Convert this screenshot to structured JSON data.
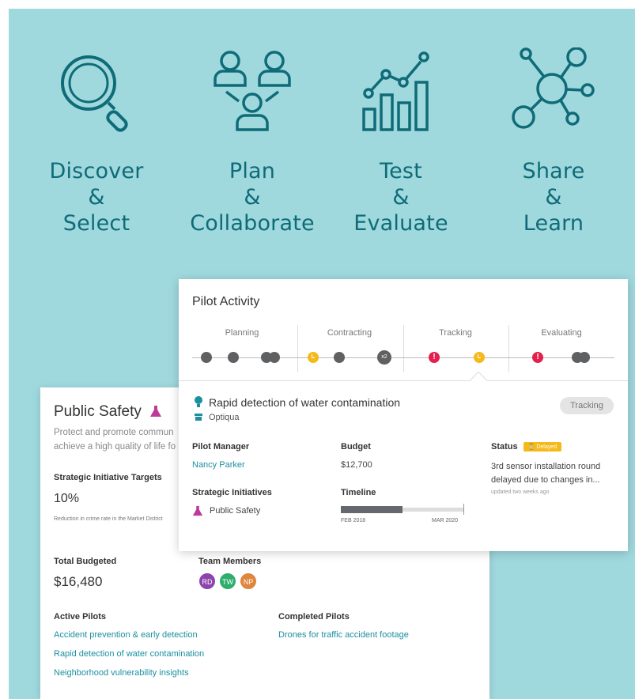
{
  "steps": [
    {
      "icon": "magnifier-icon",
      "line1": "Discover",
      "line2": "&",
      "line3": "Select"
    },
    {
      "icon": "people-icon",
      "line1": "Plan",
      "line2": "&",
      "line3": "Collaborate"
    },
    {
      "icon": "bar-chart-icon",
      "line1": "Test",
      "line2": "&",
      "line3": "Evaluate"
    },
    {
      "icon": "network-icon",
      "line1": "Share",
      "line2": "&",
      "line3": "Learn"
    }
  ],
  "colors": {
    "background": "#9fd9de",
    "teal_text": "#0f6b77",
    "link": "#1a8fa0",
    "delayed": "#f5b91a",
    "alert": "#e4204f",
    "magenta": "#c0399a"
  },
  "public_safety": {
    "title": "Public Safety",
    "description_line1": "Protect and promote commun",
    "description_line2": "achieve a high quality of life fo",
    "targets_label": "Strategic Initiative Targets",
    "target_value": "10%",
    "target_note": "Reduction in crime rate in the Market District",
    "total_label": "Total Budgeted",
    "total_value": "$16,480",
    "team_label": "Team Members",
    "team": [
      {
        "initials": "RD",
        "color": "#8e44ad"
      },
      {
        "initials": "TW",
        "color": "#2eae6d"
      },
      {
        "initials": "NP",
        "color": "#e0853c"
      }
    ],
    "active_label": "Active Pilots",
    "active_pilots": [
      "Accident prevention & early detection",
      "Rapid detection of water contamination",
      "Neighborhood vulnerability insights"
    ],
    "completed_label": "Completed Pilots",
    "completed_pilots": [
      "Drones for traffic accident footage"
    ]
  },
  "pilot_activity": {
    "title": "Pilot Activity",
    "stages": [
      "Planning",
      "Contracting",
      "Tracking",
      "Evaluating"
    ],
    "x2_label": "x2",
    "detail": {
      "title": "Rapid detection of water contamination",
      "org": "Optiqua",
      "state_pill": "Tracking",
      "manager_label": "Pilot Manager",
      "manager": "Nancy Parker",
      "budget_label": "Budget",
      "budget": "$12,700",
      "status_label": "Status",
      "status_badge": "Delayed",
      "status_text": "3rd sensor installation round delayed due to changes in...",
      "updated": "updated two weeks ago",
      "initiatives_label": "Strategic Initiatives",
      "initiative": "Public Safety",
      "timeline_label": "Timeline",
      "timeline_start": "FEB 2018",
      "timeline_end": "MAR 2020",
      "timeline_progress": 0.5
    }
  }
}
